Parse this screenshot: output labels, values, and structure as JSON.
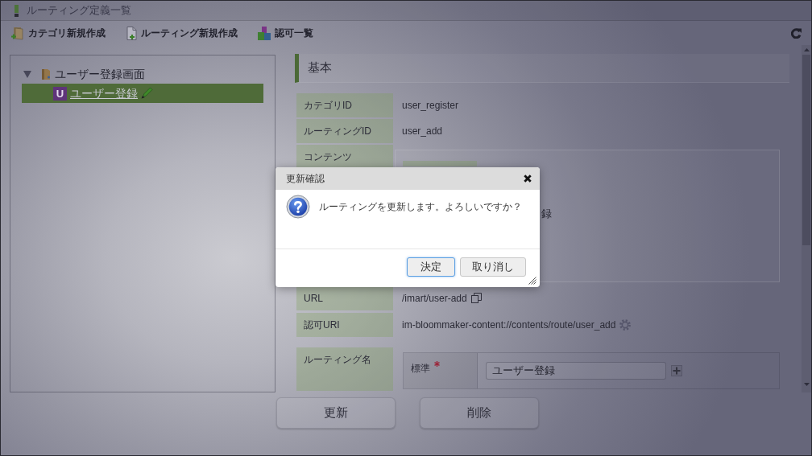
{
  "window": {
    "title": "ルーティング定義一覧"
  },
  "toolbar": {
    "items": [
      {
        "label": "カテゴリ新規作成"
      },
      {
        "label": "ルーティング新規作成"
      },
      {
        "label": "認可一覧"
      }
    ]
  },
  "tree": {
    "items": [
      {
        "label": "ユーザー登録画面",
        "expanded": true,
        "selected": false,
        "children": [
          {
            "label": "ユーザー登録",
            "badge": "U",
            "selected": true
          }
        ]
      }
    ]
  },
  "section": {
    "title": "基本"
  },
  "fields": [
    {
      "kind": "plain",
      "label": "カテゴリID",
      "value": "user_register"
    },
    {
      "kind": "plain",
      "label": "ルーティングID",
      "value": "user_add"
    },
    {
      "kind": "panel",
      "label": "コンテンツ",
      "value": "録"
    },
    {
      "kind": "copy",
      "label": "URL",
      "value": "/imart/user-add"
    },
    {
      "kind": "settings",
      "label": "認可URI",
      "value": "im-bloommaker-content://contents/route/user_add"
    },
    {
      "kind": "localized",
      "label": "ルーティング名",
      "names": [
        {
          "locale": "標準",
          "required": true,
          "value": "ユーザー登録"
        }
      ]
    }
  ],
  "actions": [
    {
      "label": "更新"
    },
    {
      "label": "削除"
    }
  ],
  "dialog": {
    "title": "更新確認",
    "message": "ルーティングを更新します。よろしいですか？",
    "buttons": [
      {
        "label": "決定",
        "focused": true
      },
      {
        "label": "取り消し",
        "focused": false
      }
    ]
  }
}
